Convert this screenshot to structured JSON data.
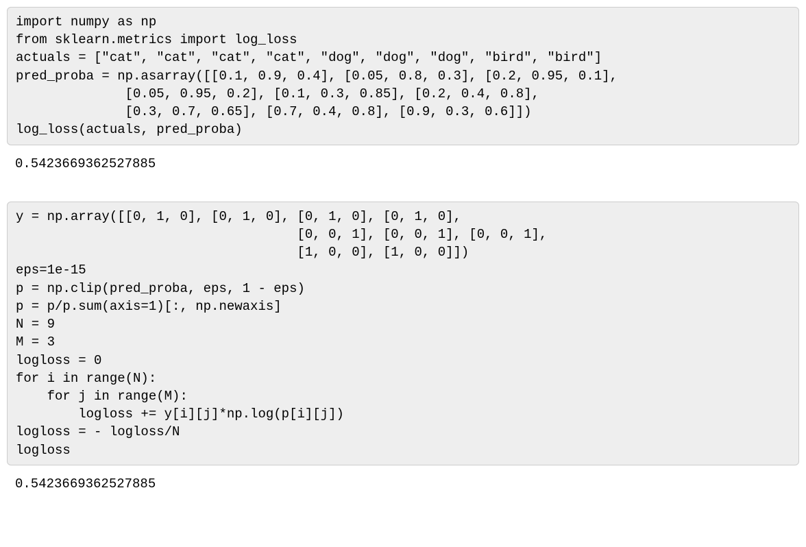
{
  "cell1": {
    "lines": [
      "import numpy as np",
      "from sklearn.metrics import log_loss",
      "actuals = [\"cat\", \"cat\", \"cat\", \"cat\", \"dog\", \"dog\", \"dog\", \"bird\", \"bird\"]",
      "pred_proba = np.asarray([[0.1, 0.9, 0.4], [0.05, 0.8, 0.3], [0.2, 0.95, 0.1],",
      "              [0.05, 0.95, 0.2], [0.1, 0.3, 0.85], [0.2, 0.4, 0.8],",
      "              [0.3, 0.7, 0.65], [0.7, 0.4, 0.8], [0.9, 0.3, 0.6]])",
      "log_loss(actuals, pred_proba)"
    ],
    "output": "0.5423669362527885"
  },
  "cell2": {
    "lines": [
      "y = np.array([[0, 1, 0], [0, 1, 0], [0, 1, 0], [0, 1, 0],",
      "                                    [0, 0, 1], [0, 0, 1], [0, 0, 1],",
      "                                    [1, 0, 0], [1, 0, 0]])",
      "eps=1e-15",
      "p = np.clip(pred_proba, eps, 1 - eps)",
      "p = p/p.sum(axis=1)[:, np.newaxis]",
      "N = 9",
      "M = 3",
      "logloss = 0",
      "for i in range(N):",
      "    for j in range(M):",
      "        logloss += y[i][j]*np.log(p[i][j])",
      "logloss = - logloss/N",
      "logloss"
    ],
    "output": "0.5423669362527885"
  }
}
